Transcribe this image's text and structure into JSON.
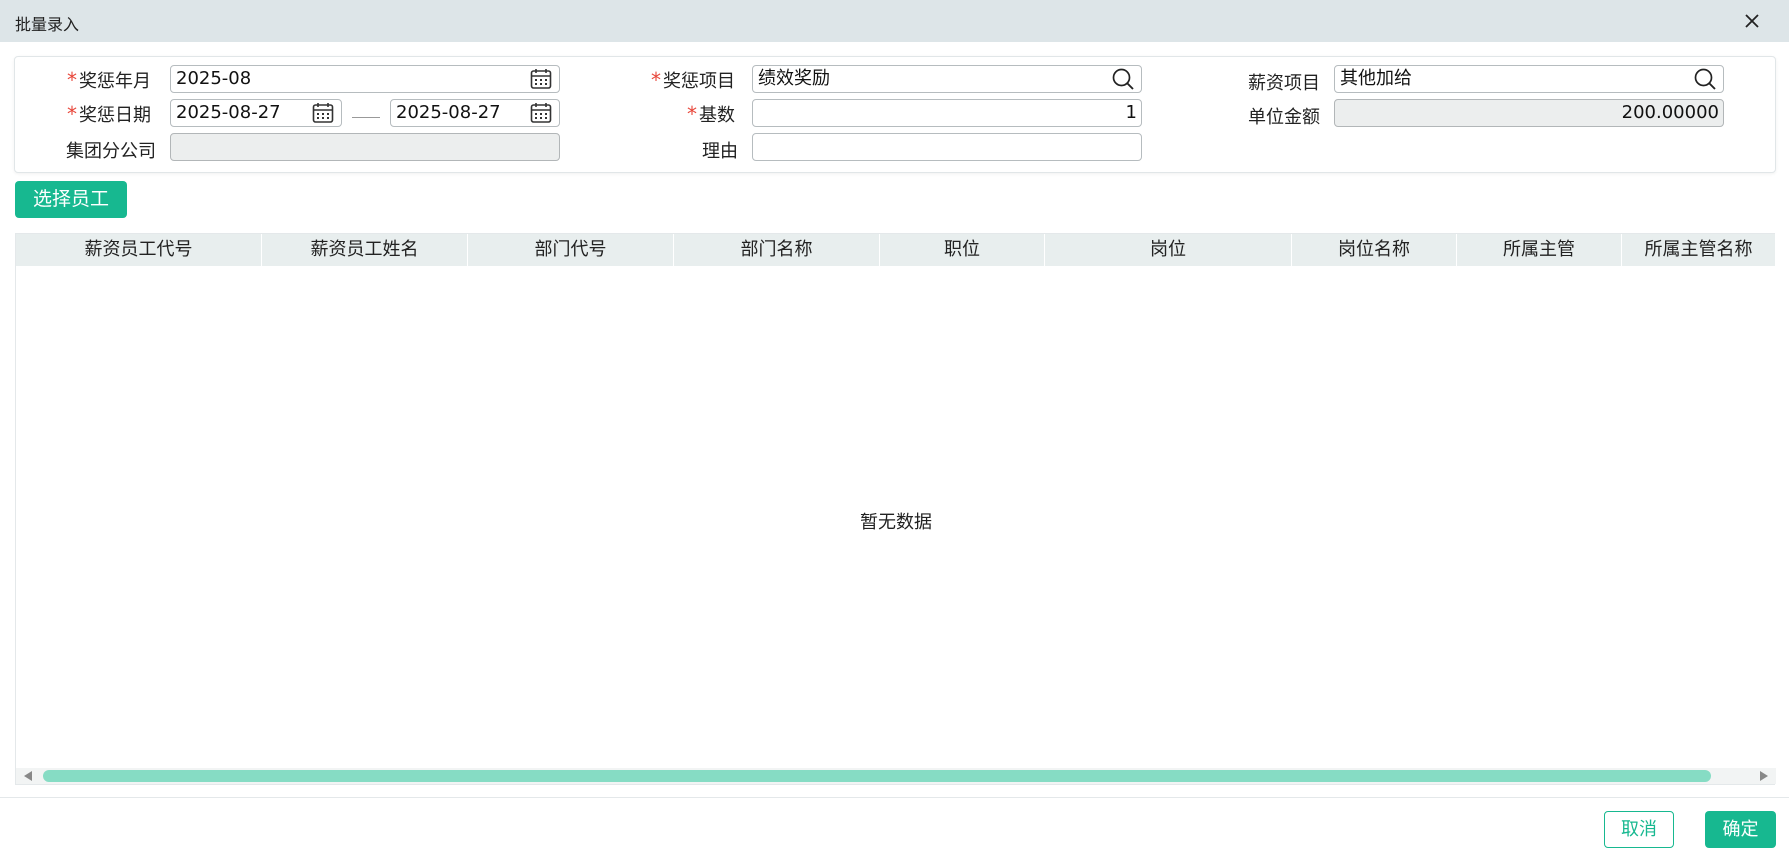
{
  "dialog": {
    "title": "批量录入"
  },
  "form": {
    "reward_month": {
      "label": "奖惩年月",
      "value": "2025-08",
      "required": true
    },
    "reward_item": {
      "label": "奖惩项目",
      "value": "绩效奖励",
      "required": true
    },
    "salary_item": {
      "label": "薪资项目",
      "value": "其他加给"
    },
    "reward_date": {
      "label": "奖惩日期",
      "start": "2025-08-27",
      "end": "2025-08-27",
      "required": true
    },
    "base_count": {
      "label": "基数",
      "value": "1",
      "required": true
    },
    "unit_amount": {
      "label": "单位金额",
      "value": "200.00000"
    },
    "group_company": {
      "label": "集团分公司",
      "value": ""
    },
    "reason": {
      "label": "理由",
      "value": ""
    },
    "required_mark": "*"
  },
  "toolbar": {
    "select_employee_label": "选择员工"
  },
  "table": {
    "columns": [
      "薪资员工代号",
      "薪资员工姓名",
      "部门代号",
      "部门名称",
      "职位",
      "岗位",
      "岗位名称",
      "所属主管",
      "所属主管名称"
    ],
    "rows": [],
    "empty_text": "暂无数据"
  },
  "footer": {
    "cancel_label": "取消",
    "ok_label": "确定"
  },
  "icons": [
    "close-icon",
    "calendar-icon",
    "search-icon",
    "scroll-left-icon",
    "scroll-right-icon"
  ],
  "colors": {
    "accent": "#17b890",
    "required": "#e8463a",
    "scrollbar_thumb": "#86dcc4",
    "header_bg": "#e8eeee"
  }
}
